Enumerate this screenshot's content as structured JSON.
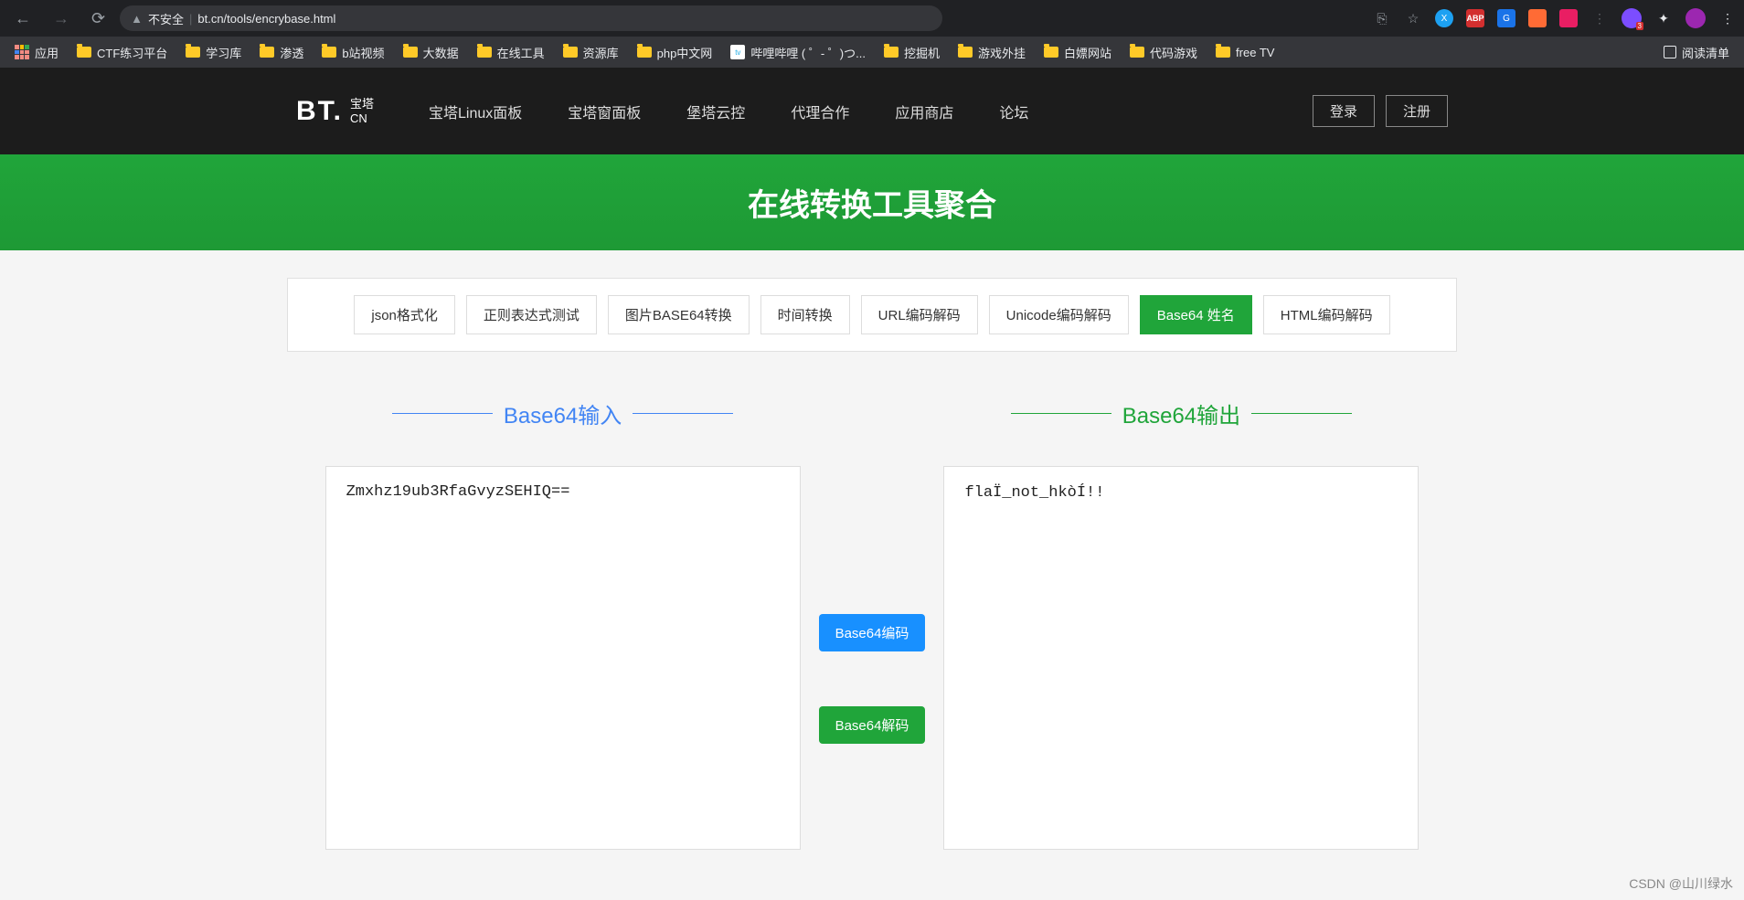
{
  "browser": {
    "url_warning": "不安全",
    "url": "bt.cn/tools/encrybase.html",
    "bookmarks": [
      {
        "type": "apps",
        "label": "应用"
      },
      {
        "type": "folder",
        "label": "CTF练习平台"
      },
      {
        "type": "folder",
        "label": "学习库"
      },
      {
        "type": "folder",
        "label": "渗透"
      },
      {
        "type": "folder",
        "label": "b站视频"
      },
      {
        "type": "folder",
        "label": "大数据"
      },
      {
        "type": "folder",
        "label": "在线工具"
      },
      {
        "type": "folder",
        "label": "资源库"
      },
      {
        "type": "folder",
        "label": "php中文网"
      },
      {
        "type": "bili",
        "label": "哔哩哔哩 ( ゜- ゜)つ..."
      },
      {
        "type": "folder",
        "label": "挖掘机"
      },
      {
        "type": "folder",
        "label": "游戏外挂"
      },
      {
        "type": "folder",
        "label": "白嫖网站"
      },
      {
        "type": "folder",
        "label": "代码游戏"
      },
      {
        "type": "folder",
        "label": "free TV"
      }
    ],
    "reading_list": "阅读清单"
  },
  "site": {
    "logo_text": "BT.",
    "logo_cn_top": "宝塔",
    "logo_cn_bottom": "CN",
    "nav": [
      "宝塔Linux面板",
      "宝塔窗面板",
      "堡塔云控",
      "代理合作",
      "应用商店",
      "论坛"
    ],
    "login": "登录",
    "register": "注册"
  },
  "banner": {
    "title": "在线转换工具聚合"
  },
  "tabs": [
    {
      "label": "json格式化",
      "active": false
    },
    {
      "label": "正则表达式测试",
      "active": false
    },
    {
      "label": "图片BASE64转换",
      "active": false
    },
    {
      "label": "时间转换",
      "active": false
    },
    {
      "label": "URL编码解码",
      "active": false
    },
    {
      "label": "Unicode编码解码",
      "active": false
    },
    {
      "label": "Base64 姓名",
      "active": true
    },
    {
      "label": "HTML编码解码",
      "active": false
    }
  ],
  "converter": {
    "input_title": "Base64输入",
    "output_title": "Base64输出",
    "input_value": "Zmxhz19ub3RfaGvyzSEHIQ==",
    "output_value": "flaÏ_not_hkòÍ!\u0007!",
    "encode_btn": "Base64编码",
    "decode_btn": "Base64解码"
  },
  "watermark": "CSDN @山川绿水"
}
